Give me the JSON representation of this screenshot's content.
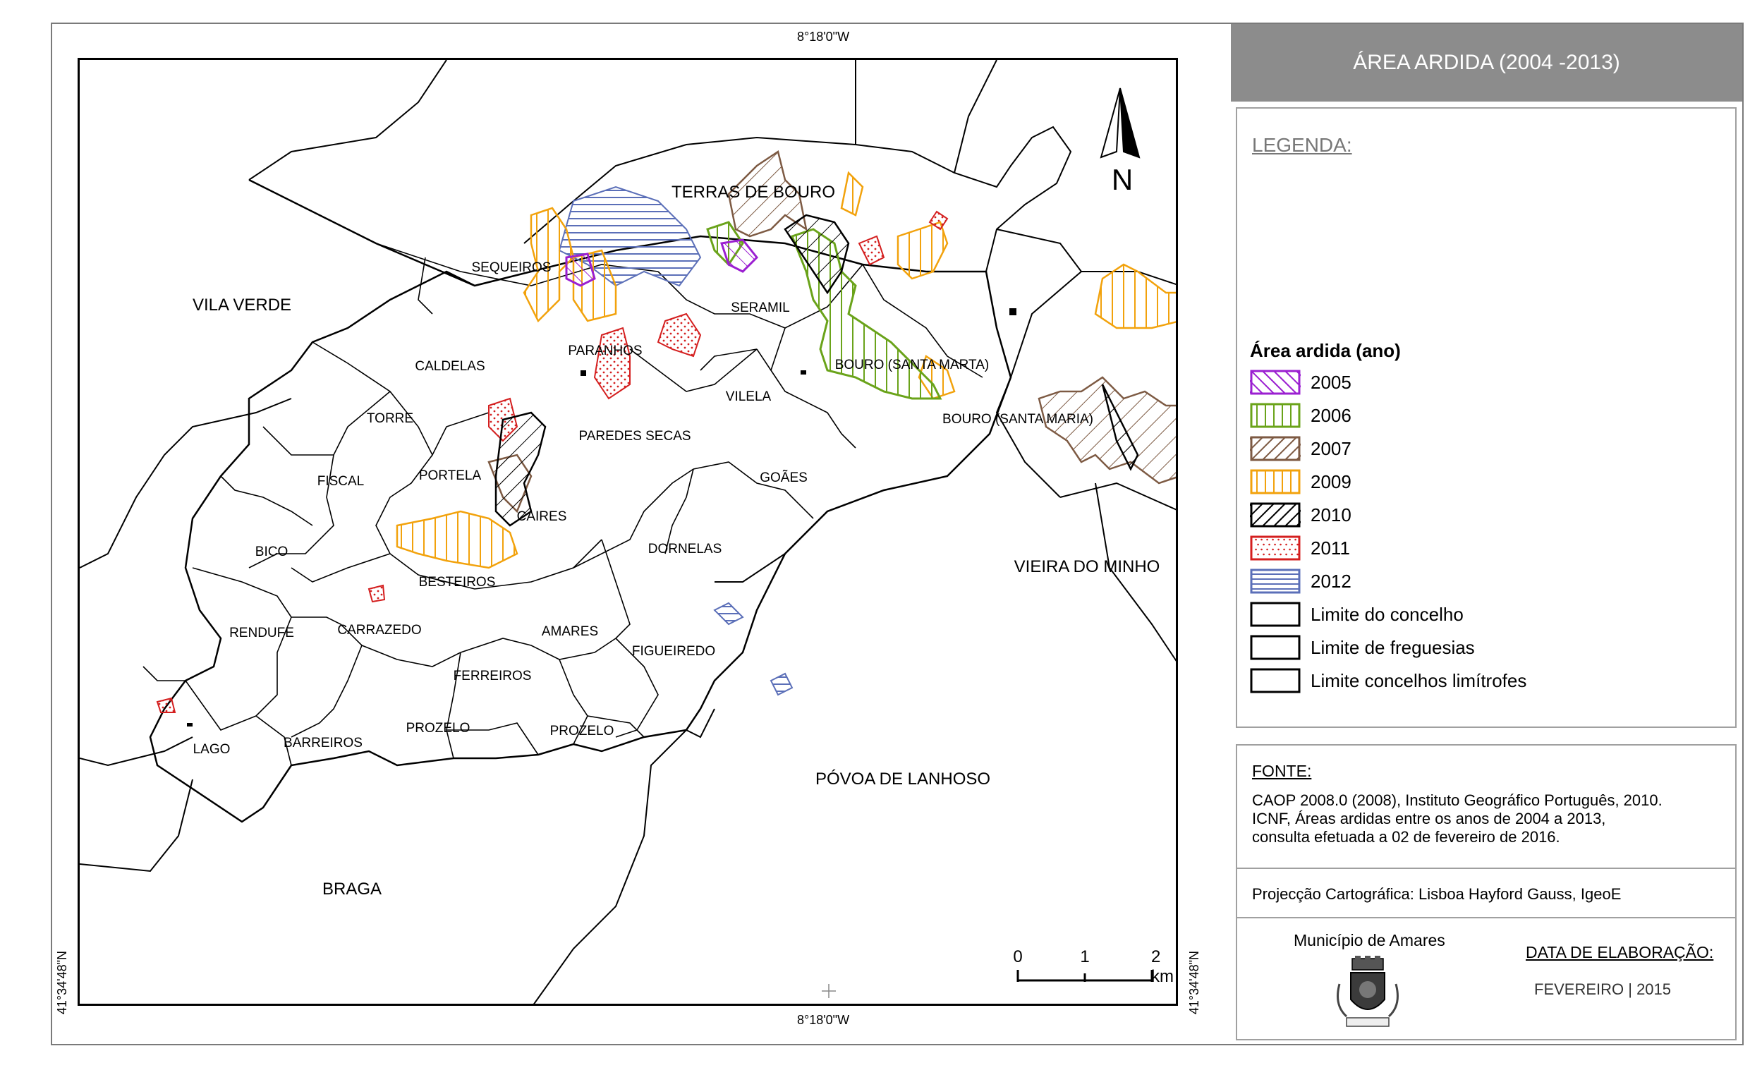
{
  "title": "ÁREA ARDIDA (2004 -2013)",
  "coords": {
    "top": "8°18'0\"W",
    "bottom": "8°18'0\"W",
    "left": "41°34'48\"N",
    "right": "41°34'48\"N"
  },
  "north_label": "N",
  "legend": {
    "heading": "LEGENDA:",
    "subheading": "Área ardida (ano)",
    "items": [
      {
        "label": "2005",
        "color": "#9b1fd1",
        "pattern": "diag-back"
      },
      {
        "label": "2006",
        "color": "#6aa31a",
        "pattern": "vert"
      },
      {
        "label": "2007",
        "color": "#7d5a43",
        "pattern": "diag"
      },
      {
        "label": "2009",
        "color": "#f2a20c",
        "pattern": "vert"
      },
      {
        "label": "2010",
        "color": "#000000",
        "pattern": "diag"
      },
      {
        "label": "2011",
        "color": "#d41f1f",
        "pattern": "dots"
      },
      {
        "label": "2012",
        "color": "#5b6fb8",
        "pattern": "horiz"
      },
      {
        "label": "Limite do concelho",
        "color": "#000000",
        "pattern": "none"
      },
      {
        "label": "Limite de freguesias",
        "color": "#000000",
        "pattern": "none"
      },
      {
        "label": "Limite concelhos limítrofes",
        "color": "#000000",
        "pattern": "none"
      }
    ]
  },
  "source": {
    "heading": "FONTE:",
    "lines": [
      "CAOP 2008.0 (2008), Instituto Geográfico Português, 2010.",
      "ICNF, Áreas ardidas entre os anos de 2004 a 2013,",
      "consulta efetuada a 02 de fevereiro de 2016."
    ]
  },
  "projection": "Projecção Cartográfica: Lisboa Hayford Gauss, IgeoE",
  "municipality": "Município de Amares",
  "date_heading": "DATA DE ELABORAÇÃO:",
  "date_value": "FEVEREIRO | 2015",
  "scale": {
    "labels": [
      "0",
      "1",
      "2 km"
    ]
  },
  "places": [
    {
      "name": "TERRAS DE BOURO",
      "size": "lg"
    },
    {
      "name": "VILA VERDE",
      "size": "lg"
    },
    {
      "name": "SEQUEIROS",
      "size": "sm"
    },
    {
      "name": "SERAMIL",
      "size": "sm"
    },
    {
      "name": "PARANHOS",
      "size": "sm"
    },
    {
      "name": "CALDELAS",
      "size": "sm"
    },
    {
      "name": "BOURO (SANTA MARTA)",
      "size": "sm"
    },
    {
      "name": "VILELA",
      "size": "sm"
    },
    {
      "name": "TORRE",
      "size": "sm"
    },
    {
      "name": "PAREDES SECAS",
      "size": "sm"
    },
    {
      "name": "BOURO (SANTA MARIA)",
      "size": "sm"
    },
    {
      "name": "FISCAL",
      "size": "sm"
    },
    {
      "name": "PORTELA",
      "size": "sm"
    },
    {
      "name": "GOÃES",
      "size": "sm"
    },
    {
      "name": "CAIRES",
      "size": "sm"
    },
    {
      "name": "DORNELAS",
      "size": "sm"
    },
    {
      "name": "BICO",
      "size": "sm"
    },
    {
      "name": "VIEIRA DO MINHO",
      "size": "lg"
    },
    {
      "name": "BESTEIROS",
      "size": "sm"
    },
    {
      "name": "RENDUFE",
      "size": "sm"
    },
    {
      "name": "CARRAZEDO",
      "size": "sm"
    },
    {
      "name": "AMARES",
      "size": "sm"
    },
    {
      "name": "FIGUEIREDO",
      "size": "sm"
    },
    {
      "name": "FERREIROS",
      "size": "sm"
    },
    {
      "name": "PROZELO",
      "size": "sm"
    },
    {
      "name": "PROZELO",
      "size": "sm"
    },
    {
      "name": "LAGO",
      "size": "sm"
    },
    {
      "name": "BARREIROS",
      "size": "sm"
    },
    {
      "name": "PÓVOA DE LANHOSO",
      "size": "lg"
    },
    {
      "name": "BRAGA",
      "size": "lg"
    }
  ]
}
